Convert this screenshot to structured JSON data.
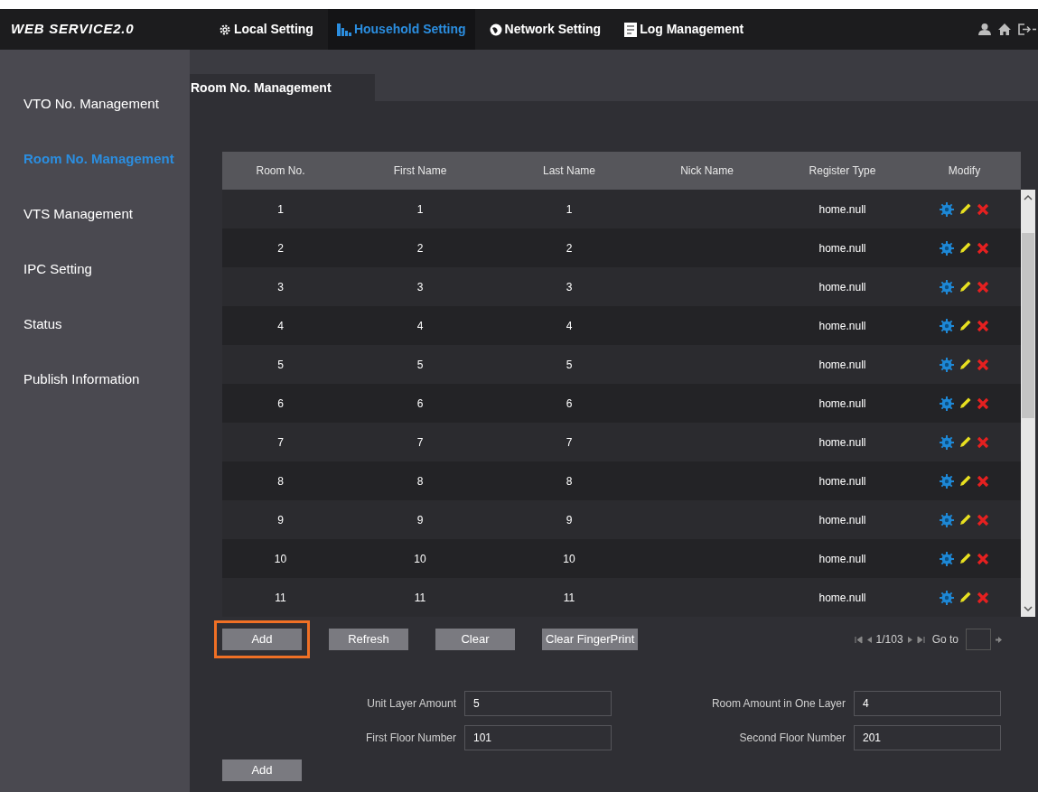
{
  "nav": {
    "logo": "WEB SERVICE2.0",
    "tabs": [
      {
        "label": "Local Setting",
        "selected": false
      },
      {
        "label": "Household Setting",
        "selected": true
      },
      {
        "label": "Network Setting",
        "selected": false
      },
      {
        "label": "Log Management",
        "selected": false
      }
    ]
  },
  "sidebar": {
    "items": [
      {
        "label": "VTO No. Management",
        "selected": false
      },
      {
        "label": "Room No. Management",
        "selected": true
      },
      {
        "label": "VTS Management",
        "selected": false
      },
      {
        "label": "IPC Setting",
        "selected": false
      },
      {
        "label": "Status",
        "selected": false
      },
      {
        "label": "Publish Information",
        "selected": false
      }
    ]
  },
  "content_tab": {
    "label": "Room No. Management"
  },
  "table": {
    "columns": [
      "Room No.",
      "First Name",
      "Last Name",
      "Nick Name",
      "Register Type",
      "Modify"
    ],
    "rows": [
      {
        "cells": [
          "1",
          "1",
          "1",
          "",
          "home.null"
        ]
      },
      {
        "cells": [
          "2",
          "2",
          "2",
          "",
          "home.null"
        ]
      },
      {
        "cells": [
          "3",
          "3",
          "3",
          "",
          "home.null"
        ]
      },
      {
        "cells": [
          "4",
          "4",
          "4",
          "",
          "home.null"
        ]
      },
      {
        "cells": [
          "5",
          "5",
          "5",
          "",
          "home.null"
        ]
      },
      {
        "cells": [
          "6",
          "6",
          "6",
          "",
          "home.null"
        ]
      },
      {
        "cells": [
          "7",
          "7",
          "7",
          "",
          "home.null"
        ]
      },
      {
        "cells": [
          "8",
          "8",
          "8",
          "",
          "home.null"
        ]
      },
      {
        "cells": [
          "9",
          "9",
          "9",
          "",
          "home.null"
        ]
      },
      {
        "cells": [
          "10",
          "10",
          "10",
          "",
          "home.null"
        ]
      },
      {
        "cells": [
          "11",
          "11",
          "11",
          "",
          "home.null"
        ]
      }
    ]
  },
  "buttons": [
    {
      "label": "Add",
      "highlighted": true
    },
    {
      "label": "Refresh",
      "highlighted": false
    },
    {
      "label": "Clear",
      "highlighted": false
    },
    {
      "label": "Clear FingerPrint",
      "highlighted": false
    }
  ],
  "pagination": {
    "page": "1/103",
    "goto_label": "Go to"
  },
  "form": [
    {
      "label": "Unit Layer Amount",
      "value": "5"
    },
    {
      "label": "Room Amount in One Layer",
      "value": "4"
    },
    {
      "label": "First Floor Number",
      "value": "101"
    },
    {
      "label": "Second Floor Number",
      "value": "201"
    }
  ],
  "add_button": {
    "label": "Add"
  }
}
